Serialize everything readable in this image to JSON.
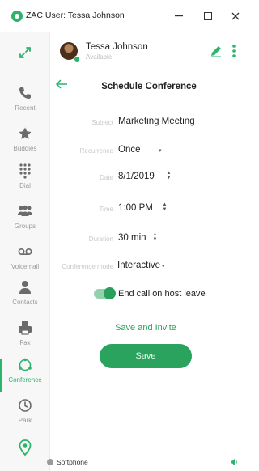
{
  "window": {
    "title": "ZAC User: Tessa Johnson"
  },
  "user": {
    "name": "Tessa Johnson",
    "status": "Available"
  },
  "sidebar": {
    "items": [
      {
        "label": "Recent",
        "icon": "phone-icon"
      },
      {
        "label": "Buddies",
        "icon": "star-icon"
      },
      {
        "label": "Dial",
        "icon": "dialpad-icon"
      },
      {
        "label": "Groups",
        "icon": "groups-icon"
      },
      {
        "label": "Voicemail",
        "icon": "voicemail-icon"
      },
      {
        "label": "Contacts",
        "icon": "contact-icon"
      },
      {
        "label": "Fax",
        "icon": "fax-icon"
      },
      {
        "label": "Conference",
        "icon": "conference-icon"
      },
      {
        "label": "Park",
        "icon": "park-icon"
      },
      {
        "label": "",
        "icon": "location-icon"
      }
    ],
    "active": "Conference"
  },
  "form": {
    "title": "Schedule Conference",
    "subject_label": "Subject",
    "subject_value": "Marketing Meeting",
    "recurrence_label": "Recurrence",
    "recurrence_value": "Once",
    "date_label": "Date",
    "date_value": "8/1/2019",
    "time_label": "Time",
    "time_value": "1:00 PM",
    "duration_label": "Duration",
    "duration_value": "30 min",
    "mode_label": "Conference mode",
    "mode_value": "Interactive",
    "end_on_host_leave_label": "End call on host leave",
    "end_on_host_leave_on": true,
    "save_invite_label": "Save and Invite",
    "save_label": "Save"
  },
  "footer": {
    "softphone_label": "Softphone"
  },
  "colors": {
    "accent": "#2db36b",
    "button": "#29a35d"
  }
}
